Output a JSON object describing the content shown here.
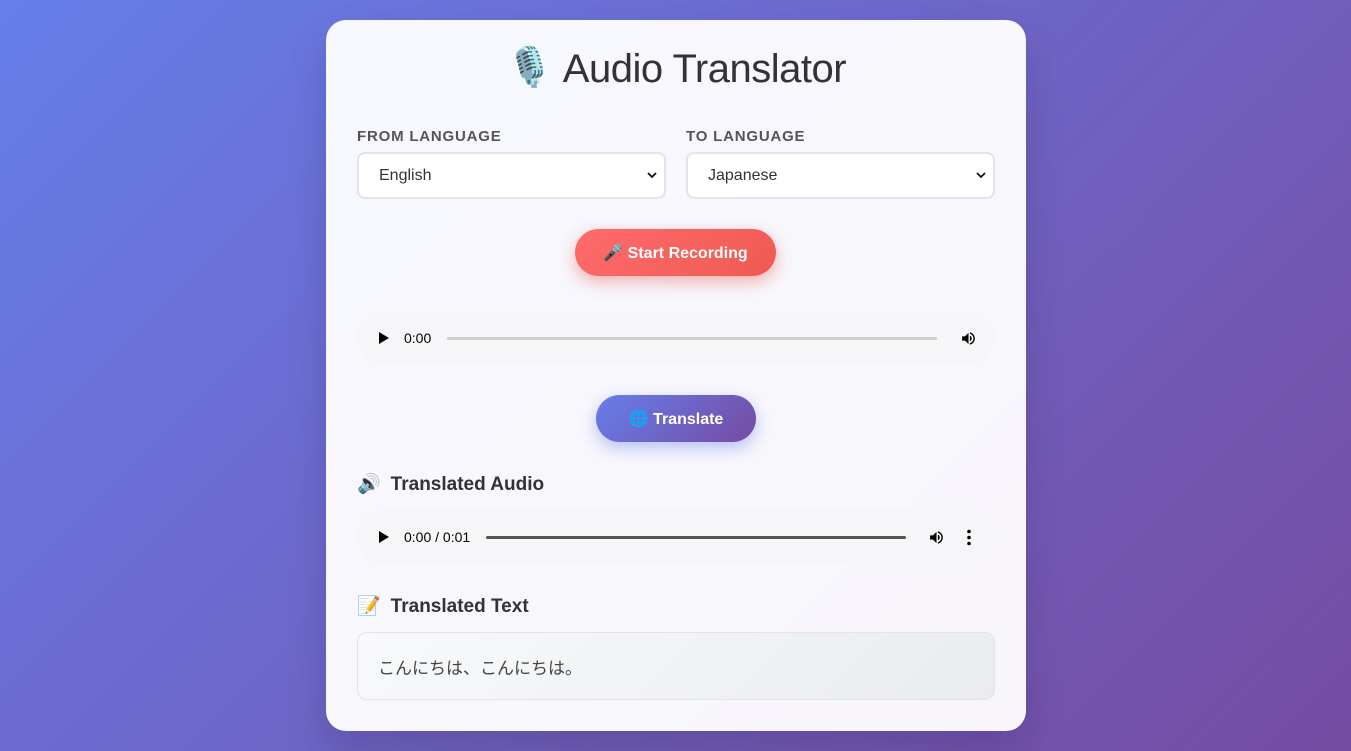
{
  "app": {
    "title": "Audio Translator",
    "title_icon": "🎙️",
    "title_icon_name": "microphone-icon"
  },
  "languages": {
    "from_label": "From Language",
    "from_value": "English",
    "to_label": "To Language",
    "to_value": "Japanese"
  },
  "recording": {
    "button_label": "🎤 Start Recording",
    "player_time": "0:00",
    "player_progress": 0
  },
  "translate": {
    "button_label": "🌐 Translate"
  },
  "translated_audio": {
    "heading": "Translated Audio",
    "heading_icon": "🔊",
    "heading_icon_name": "speaker-icon",
    "player_time": "0:00 / 0:01",
    "player_progress": 0
  },
  "translated_text": {
    "heading": "Translated Text",
    "heading_icon": "📝",
    "heading_icon_name": "memo-icon",
    "content": "こんにちは、こんにちは。"
  },
  "colors": {
    "background_gradient_start": "#667eea",
    "background_gradient_end": "#764ba2",
    "record_button": "#ff6b6b",
    "translate_button": "#667eea"
  }
}
